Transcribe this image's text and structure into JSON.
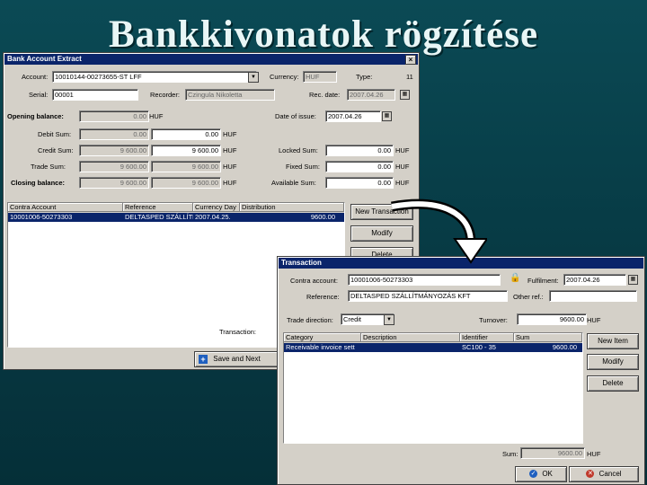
{
  "slide": {
    "title": "Bankkivonatok rögzítése"
  },
  "extract_window": {
    "title": "Bank Account Extract",
    "close": "×",
    "account_label": "Account:",
    "account_value": "10010144-00273655-ST LFF",
    "currency_label": "Currency:",
    "currency_value": "HUF",
    "type_label": "Type:",
    "type_value": "11",
    "serial_label": "Serial:",
    "serial_value": "00001",
    "recorder_label": "Recorder:",
    "recorder_value": "Czingula Nikoletta",
    "rec_date_label": "Rec. date:",
    "rec_date_value": "2007.04.26",
    "date_of_issue_label": "Date of issue:",
    "date_of_issue_value": "2007.04.26",
    "opening_label": "Opening balance:",
    "opening_value": "0.00",
    "debit_label": "Debit Sum:",
    "debit_value": "0.00",
    "debit_value2": "0.00",
    "credit_label": "Credit Sum:",
    "credit_value": "9 600.00",
    "credit_value2": "9 600.00",
    "trade_label": "Trade Sum:",
    "trade_value": "9 600.00",
    "trade_value2": "9 600.00",
    "closing_label": "Closing balance:",
    "closing_value": "9 600.00",
    "closing_value2": "9 600.00",
    "unit": "HUF",
    "locked_label": "Locked Sum:",
    "locked_value": "0.00",
    "fixed_label": "Fixed Sum:",
    "fixed_value": "0.00",
    "available_label": "Available Sum:",
    "available_value": "0.00",
    "grid": {
      "columns": [
        "Contra Account",
        "Reference",
        "Currency Day",
        "Distribution"
      ],
      "row": [
        "10001006-50273303",
        "DELTASPED SZÁLLÍTMÁN",
        "2007.04.25.",
        "9600.00"
      ]
    },
    "buttons": {
      "new_transaction": "New Transaction",
      "modify": "Modify",
      "delete": "Delete"
    },
    "transaction_label": "Transaction:",
    "save_next": "Save and Next"
  },
  "transaction_window": {
    "title": "Transaction",
    "contra_label": "Contra account:",
    "contra_value": "10001006-50273303",
    "fulfilment_label": "Fulfilment:",
    "fulfilment_value": "2007.04.26",
    "reference_label": "Reference:",
    "reference_value": "DELTASPED SZÁLLÍTMÁNYOZÁS KFT",
    "other_ref_label": "Other ref.:",
    "other_ref_value": "",
    "trade_direction_label": "Trade direction:",
    "trade_direction_value": "Credit",
    "turnover_label": "Turnover:",
    "turnover_value": "9600.00",
    "unit": "HUF",
    "grid": {
      "columns": [
        "Category",
        "Description",
        "Identifier",
        "Sum"
      ],
      "row": [
        "Receivable invoice sett",
        "",
        "SC100 - 35",
        "9600.00"
      ]
    },
    "buttons": {
      "new_item": "New Item",
      "modify": "Modify",
      "delete": "Delete",
      "ok": "OK",
      "cancel": "Cancel"
    },
    "sum_label": "Sum:",
    "sum_value": "9600.00"
  },
  "colors": {
    "background": "#073c46",
    "titlebar": "#0a246a",
    "selection": "#0a246a"
  }
}
